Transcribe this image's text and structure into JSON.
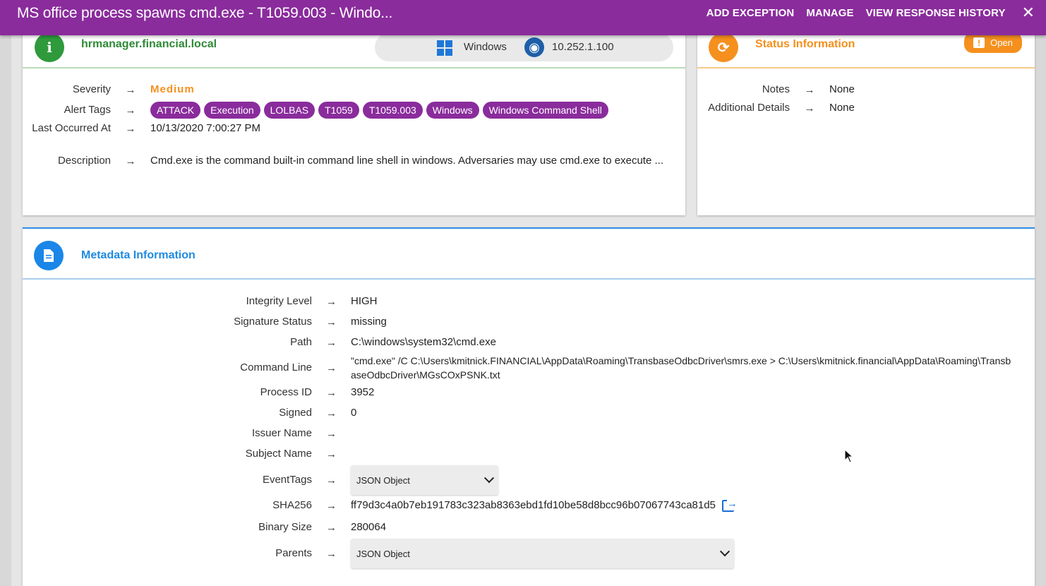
{
  "header": {
    "title": "MS office process spawns cmd.exe - T1059.003 - Windo...",
    "actions": [
      "ADD EXCEPTION",
      "MANAGE",
      "VIEW RESPONSE HISTORY"
    ],
    "close_icon": "close-icon"
  },
  "host_card": {
    "hostname": "hrmanager.financial.local",
    "os": "Windows",
    "ip": "10.252.1.100",
    "fields": [
      {
        "label": "Severity",
        "value": "Medium"
      },
      {
        "label": "Alert Tags",
        "tags": [
          "ATTACK",
          "Execution",
          "LOLBAS",
          "T1059",
          "T1059.003",
          "Windows",
          "Windows Command Shell"
        ]
      },
      {
        "label": "Last Occurred At",
        "value": "10/13/2020 7:00:27 PM"
      },
      {
        "label": "Description",
        "value": "Cmd.exe is the command built-in command line shell in windows. Adversaries may use cmd.exe to execute ..."
      }
    ]
  },
  "status_card": {
    "title": "Status Information",
    "badge": "Open",
    "fields": [
      {
        "label": "Notes",
        "value": "None"
      },
      {
        "label": "Additional Details",
        "value": "None"
      }
    ]
  },
  "metadata_card": {
    "title": "Metadata Information",
    "fields": [
      {
        "label": "Integrity Level",
        "value": "HIGH"
      },
      {
        "label": "Signature Status",
        "value": "missing"
      },
      {
        "label": "Path",
        "value": "C:\\windows\\system32\\cmd.exe"
      },
      {
        "label": "Command Line",
        "value": "\"cmd.exe\" /C C:\\Users\\kmitnick.FINANCIAL\\AppData\\Roaming\\TransbaseOdbcDriver\\smrs.exe > C:\\Users\\kmitnick.financial\\AppData\\Roaming\\TransbaseOdbcDriver\\MGsCOxPSNK.txt"
      },
      {
        "label": "Process ID",
        "value": "3952"
      },
      {
        "label": "Signed",
        "value": "0"
      },
      {
        "label": "Issuer Name",
        "value": ""
      },
      {
        "label": "Subject Name",
        "value": ""
      },
      {
        "label": "EventTags",
        "select": "JSON Object"
      },
      {
        "label": "SHA256",
        "value": "ff79d3c4a0b7eb191783c323ab8363ebd1fd10be58d8bcc96b07067743ca81d5"
      },
      {
        "label": "Binary Size",
        "value": "280064"
      },
      {
        "label": "Parents",
        "select": "JSON Object"
      }
    ]
  },
  "arrow": "→",
  "colors": {
    "header": "#8a2c9c",
    "tag": "#8a2c9c",
    "host_accent": "#2e9a3c",
    "status_accent": "#f5901e",
    "meta_accent": "#1f8ae0"
  }
}
